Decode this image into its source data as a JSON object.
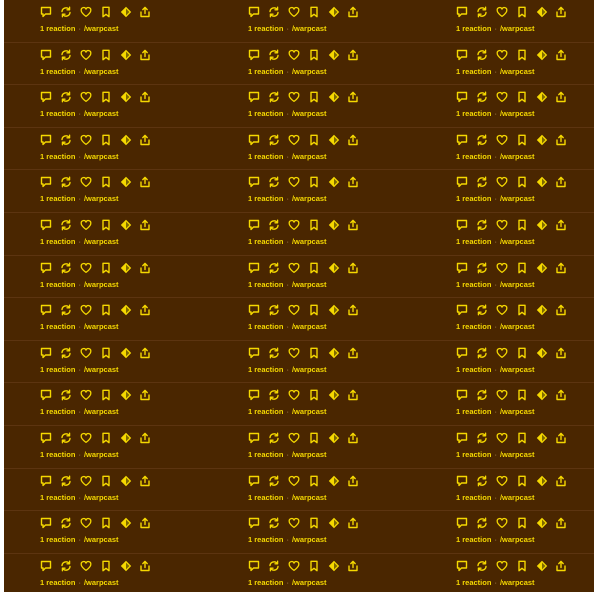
{
  "theme": {
    "background": "#4a2600",
    "accent": "#f5d800",
    "divider": "#5c3410"
  },
  "action_icons": [
    "comment-icon",
    "recast-icon",
    "heart-icon",
    "bookmark-icon",
    "tip-icon",
    "share-icon"
  ],
  "rows": [
    {
      "posts": [
        {
          "reactions": "1 reaction",
          "channel": "/warpcast"
        },
        {
          "reactions": "1 reaction",
          "channel": "/warpcast"
        },
        {
          "reactions": "1 reaction",
          "channel": "/warpcast"
        }
      ]
    },
    {
      "posts": [
        {
          "reactions": "1 reaction",
          "channel": "/warpcast"
        },
        {
          "reactions": "1 reaction",
          "channel": "/warpcast"
        },
        {
          "reactions": "1 reaction",
          "channel": "/warpcast"
        }
      ]
    },
    {
      "posts": [
        {
          "reactions": "1 reaction",
          "channel": "/warpcast"
        },
        {
          "reactions": "1 reaction",
          "channel": "/warpcast"
        },
        {
          "reactions": "1 reaction",
          "channel": "/warpcast"
        }
      ]
    },
    {
      "posts": [
        {
          "reactions": "1 reaction",
          "channel": "/warpcast"
        },
        {
          "reactions": "1 reaction",
          "channel": "/warpcast"
        },
        {
          "reactions": "1 reaction",
          "channel": "/warpcast"
        }
      ]
    },
    {
      "posts": [
        {
          "reactions": "1 reaction",
          "channel": "/warpcast"
        },
        {
          "reactions": "1 reaction",
          "channel": "/warpcast"
        },
        {
          "reactions": "1 reaction",
          "channel": "/warpcast"
        }
      ]
    },
    {
      "posts": [
        {
          "reactions": "1 reaction",
          "channel": "/warpcast"
        },
        {
          "reactions": "1 reaction",
          "channel": "/warpcast"
        },
        {
          "reactions": "1 reaction",
          "channel": "/warpcast"
        }
      ]
    },
    {
      "posts": [
        {
          "reactions": "1 reaction",
          "channel": "/warpcast"
        },
        {
          "reactions": "1 reaction",
          "channel": "/warpcast"
        },
        {
          "reactions": "1 reaction",
          "channel": "/warpcast"
        }
      ]
    },
    {
      "posts": [
        {
          "reactions": "1 reaction",
          "channel": "/warpcast"
        },
        {
          "reactions": "1 reaction",
          "channel": "/warpcast"
        },
        {
          "reactions": "1 reaction",
          "channel": "/warpcast"
        }
      ]
    },
    {
      "posts": [
        {
          "reactions": "1 reaction",
          "channel": "/warpcast"
        },
        {
          "reactions": "1 reaction",
          "channel": "/warpcast"
        },
        {
          "reactions": "1 reaction",
          "channel": "/warpcast"
        }
      ]
    },
    {
      "posts": [
        {
          "reactions": "1 reaction",
          "channel": "/warpcast"
        },
        {
          "reactions": "1 reaction",
          "channel": "/warpcast"
        },
        {
          "reactions": "1 reaction",
          "channel": "/warpcast"
        }
      ]
    },
    {
      "posts": [
        {
          "reactions": "1 reaction",
          "channel": "/warpcast"
        },
        {
          "reactions": "1 reaction",
          "channel": "/warpcast"
        },
        {
          "reactions": "1 reaction",
          "channel": "/warpcast"
        }
      ]
    },
    {
      "posts": [
        {
          "reactions": "1 reaction",
          "channel": "/warpcast"
        },
        {
          "reactions": "1 reaction",
          "channel": "/warpcast"
        },
        {
          "reactions": "1 reaction",
          "channel": "/warpcast"
        }
      ]
    },
    {
      "posts": [
        {
          "reactions": "1 reaction",
          "channel": "/warpcast"
        },
        {
          "reactions": "1 reaction",
          "channel": "/warpcast"
        },
        {
          "reactions": "1 reaction",
          "channel": "/warpcast"
        }
      ]
    },
    {
      "posts": [
        {
          "reactions": "1 reaction",
          "channel": "/warpcast"
        },
        {
          "reactions": "1 reaction",
          "channel": "/warpcast"
        },
        {
          "reactions": "1 reaction",
          "channel": "/warpcast"
        }
      ]
    }
  ]
}
